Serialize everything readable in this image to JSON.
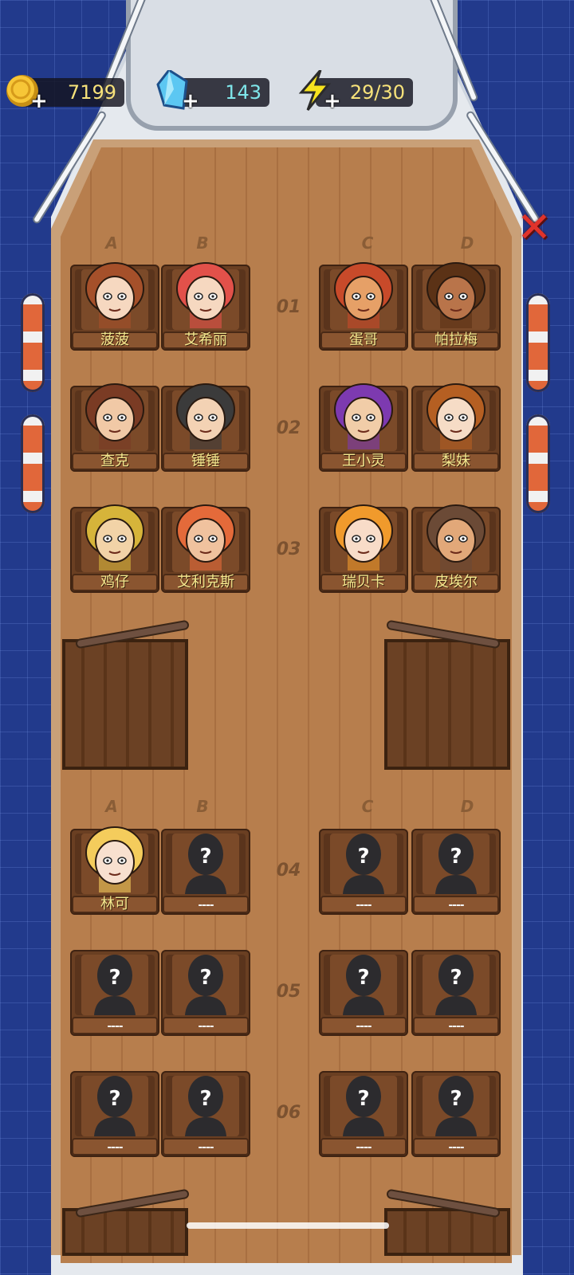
{
  "resources": {
    "coins": "7199",
    "gems": "143",
    "energy": "29/30",
    "coin_icon": "coin-icon",
    "gem_icon": "crystal-icon",
    "energy_icon": "lightning-icon",
    "plus": "+"
  },
  "close": {
    "label": "✕"
  },
  "columns": [
    "A",
    "B",
    "C",
    "D"
  ],
  "rows": [
    "01",
    "02",
    "03",
    "04",
    "05",
    "06"
  ],
  "seats": {
    "r1": [
      "菠菠",
      "艾希丽",
      "蛋哥",
      "帕拉梅"
    ],
    "r2": [
      "查克",
      "锤锤",
      "王小灵",
      "梨妹"
    ],
    "r3": [
      "鸡仔",
      "艾利克斯",
      "瑞贝卡",
      "皮埃尔"
    ],
    "r4": [
      "林可",
      "----",
      "----",
      "----"
    ],
    "r5": [
      "----",
      "----",
      "----",
      "----"
    ],
    "r6": [
      "----",
      "----",
      "----",
      "----"
    ]
  },
  "mystery_mark": "?",
  "colors": {
    "sea": "#223a8c",
    "deck": "#b77e4d",
    "name_text": "#f5e98f",
    "close": "#e0332b"
  }
}
